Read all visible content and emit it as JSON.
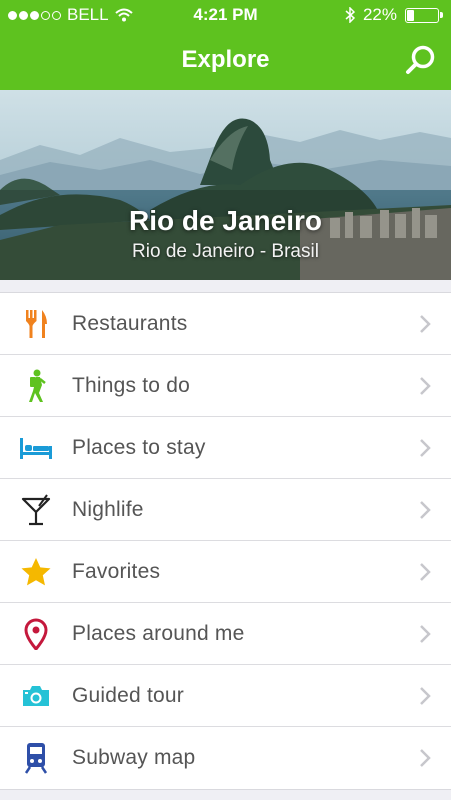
{
  "status_bar": {
    "carrier": "BELL",
    "time": "4:21 PM",
    "battery": "22%",
    "battery_level": 0.22,
    "signal_bars": 3
  },
  "nav": {
    "title": "Explore",
    "search_icon": "search-icon"
  },
  "hero": {
    "city": "Rio de Janeiro",
    "region": "Rio de Janeiro - Brasil"
  },
  "menu": {
    "items": [
      {
        "label": "Restaurants",
        "icon": "fork-knife-icon",
        "color": "#f0821e"
      },
      {
        "label": "Things to do",
        "icon": "hiker-icon",
        "color": "#5ec21f"
      },
      {
        "label": "Places to stay",
        "icon": "bed-icon",
        "color": "#1a9bd7"
      },
      {
        "label": "Nighlife",
        "icon": "cocktail-icon",
        "color": "#222222"
      },
      {
        "label": "Favorites",
        "icon": "star-icon",
        "color": "#f5b800"
      },
      {
        "label": "Places around me",
        "icon": "map-pin-icon",
        "color": "#c4183c"
      },
      {
        "label": "Guided tour",
        "icon": "camera-icon",
        "color": "#25c2d6"
      },
      {
        "label": "Subway map",
        "icon": "train-icon",
        "color": "#2e4fa8"
      }
    ]
  },
  "colors": {
    "accent": "#5ec21f",
    "background": "#efeff4"
  }
}
